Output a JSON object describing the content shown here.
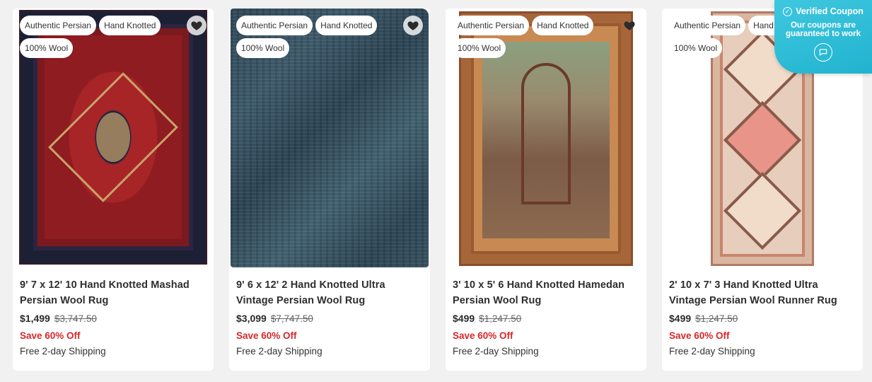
{
  "products": [
    {
      "badges": [
        "Authentic Persian",
        "Hand Knotted",
        "100% Wool"
      ],
      "title": "9' 7 x 12' 10 Hand Knotted Mashad Persian Wool Rug",
      "price": "$1,499",
      "original_price": "$3,747.50",
      "discount": "Save 60% Off",
      "shipping": "Free 2-day Shipping"
    },
    {
      "badges": [
        "Authentic Persian",
        "Hand Knotted",
        "100% Wool"
      ],
      "title": "9' 6 x 12' 2 Hand Knotted Ultra Vintage Persian Wool Rug",
      "price": "$3,099",
      "original_price": "$7,747.50",
      "discount": "Save 60% Off",
      "shipping": "Free 2-day Shipping"
    },
    {
      "badges": [
        "Authentic Persian",
        "Hand Knotted",
        "100% Wool"
      ],
      "title": "3' 10 x 5' 6 Hand Knotted Hamedan Persian Wool Rug",
      "price": "$499",
      "original_price": "$1,247.50",
      "discount": "Save 60% Off",
      "shipping": "Free 2-day Shipping"
    },
    {
      "badges": [
        "Authentic Persian",
        "Hand Knotted",
        "100% Wool"
      ],
      "title": "2' 10 x 7' 3 Hand Knotted Ultra Vintage Persian Wool Runner Rug",
      "price": "$499",
      "original_price": "$1,247.50",
      "discount": "Save 60% Off",
      "shipping": "Free 2-day Shipping"
    }
  ],
  "coupon": {
    "title": "Verified Coupon",
    "subtitle": "Our coupons are guaranteed to work",
    "icon": "chat-bubble-icon"
  },
  "colors": {
    "sale_red": "#d6272a",
    "coupon_teal": "#21b3cf",
    "background": "#f1f1f1"
  }
}
